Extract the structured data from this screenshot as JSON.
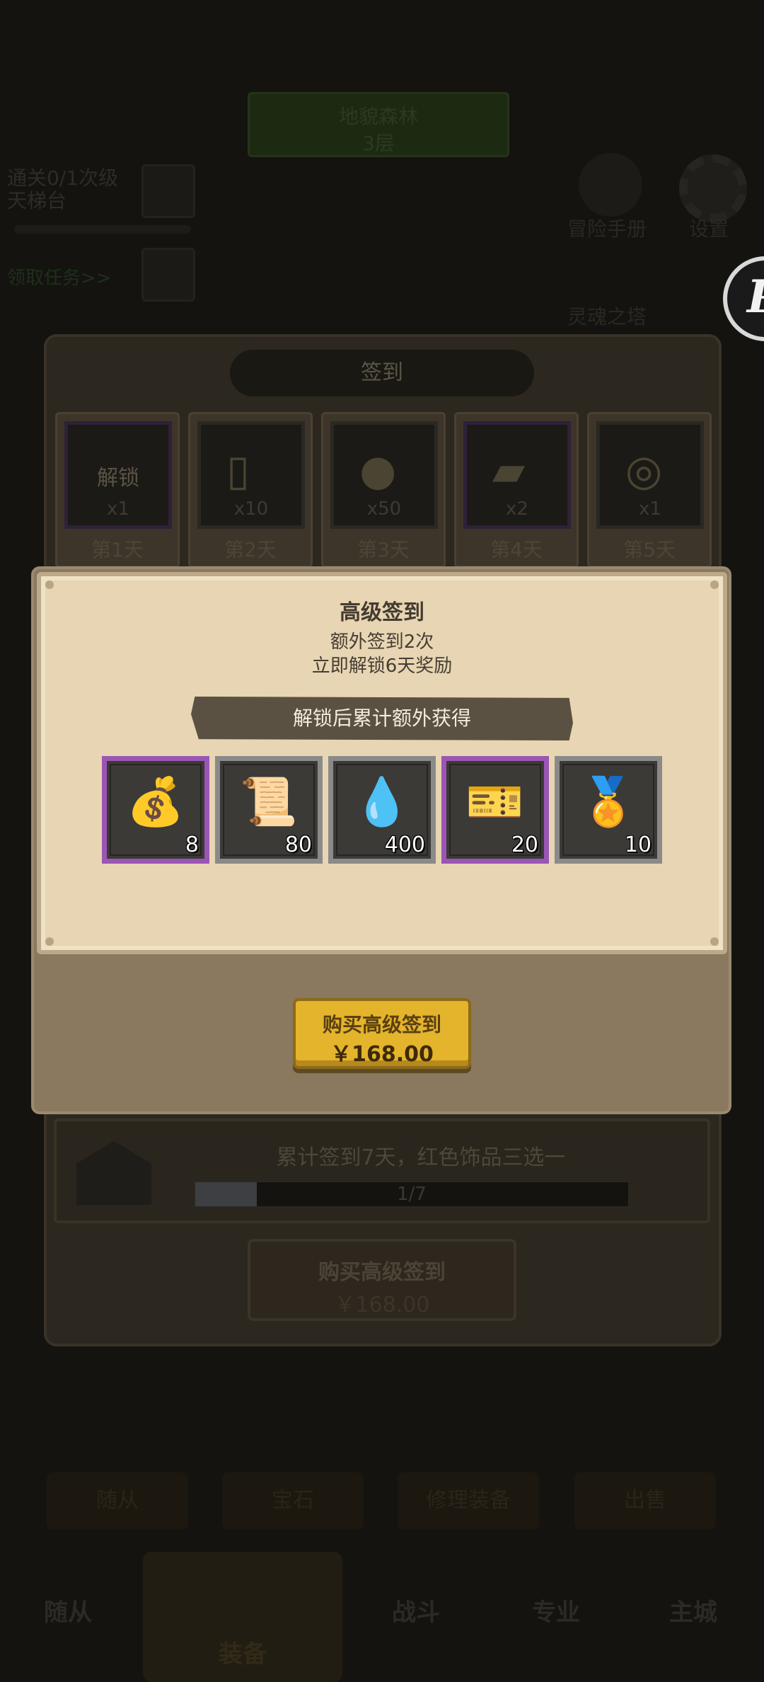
{
  "background": {
    "top_banner": {
      "line1": "地貌森林",
      "line2": "3层"
    },
    "quest_text": "通关0/1次级天梯台",
    "quest_link": "领取任务>>",
    "side_labels": [
      "冒险手册",
      "设置",
      "灵魂之塔"
    ],
    "dialog_title": "签到",
    "days": [
      {
        "label": "第1天",
        "qty": "x1",
        "status": "解锁",
        "icon": "gold-pile-icon",
        "rarity": "purple"
      },
      {
        "label": "第2天",
        "qty": "x10",
        "icon": "scroll-icon",
        "rarity": "grey"
      },
      {
        "label": "第3天",
        "qty": "x50",
        "icon": "blue-spirit-icon",
        "rarity": "grey"
      },
      {
        "label": "第4天",
        "qty": "x2",
        "icon": "gold-ticket-icon",
        "rarity": "purple"
      },
      {
        "label": "第5天",
        "qty": "x1",
        "icon": "gold-medal-icon",
        "rarity": "grey"
      }
    ],
    "cumulative": {
      "text": "累计签到7天，红色饰品三选一",
      "progress": "1/7",
      "progress_fraction": 0.142
    },
    "buy": {
      "label": "购买高级签到",
      "price": "￥168.00"
    },
    "bottom_buttons": [
      "随从",
      "宝石",
      "修理装备",
      "出售"
    ],
    "nav": {
      "followers": "随从",
      "equip": "装备",
      "battle": "战斗",
      "skill": "专业",
      "city": "主城"
    },
    "badge": "P"
  },
  "modal": {
    "title": "高级签到",
    "sub1": "额外签到2次",
    "sub2": "立即解锁6天奖励",
    "banner": "解锁后累计额外获得",
    "rewards": [
      {
        "icon": "gold-pile-icon",
        "glyph": "💰",
        "count": "8",
        "rarity": "purple"
      },
      {
        "icon": "scroll-icon",
        "glyph": "📜",
        "count": "80",
        "rarity": "grey"
      },
      {
        "icon": "blue-spirit-icon",
        "glyph": "💧",
        "count": "400",
        "rarity": "grey"
      },
      {
        "icon": "gold-ticket-icon",
        "glyph": "🎫",
        "count": "20",
        "rarity": "purple"
      },
      {
        "icon": "gold-medal-icon",
        "glyph": "🏅",
        "count": "10",
        "rarity": "grey"
      }
    ],
    "buy_label": "购买高级签到",
    "buy_price": "￥168.00"
  },
  "colors": {
    "accent_gold": "#e3b42c",
    "parchment": "#e7d5b3",
    "rarity_purple": "#9b55b5",
    "rarity_grey": "#8a8a88"
  }
}
